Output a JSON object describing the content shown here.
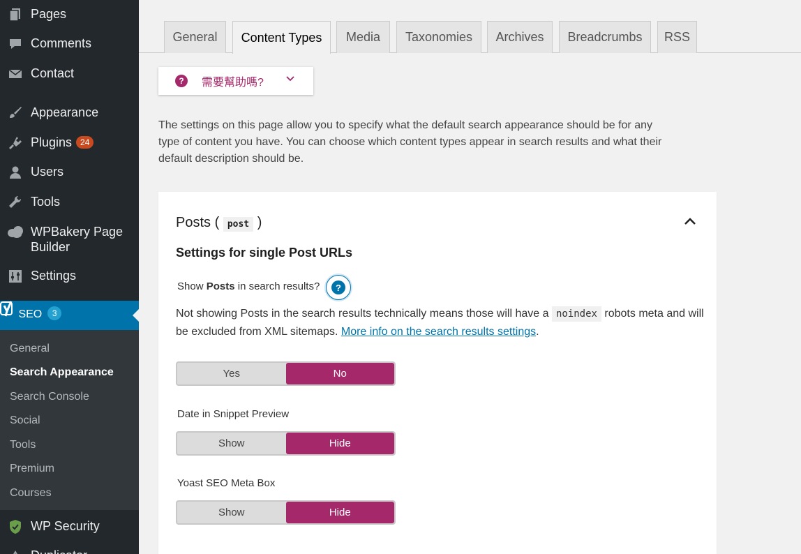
{
  "colors": {
    "sidebar_bg": "#23282d",
    "active_menu": "#0073aa",
    "accent": "#a4286a",
    "link": "#0073aa"
  },
  "sidebar": {
    "items": [
      {
        "label": "Pages",
        "icon": "pages-icon"
      },
      {
        "label": "Comments",
        "icon": "comments-icon"
      },
      {
        "label": "Contact",
        "icon": "mail-icon"
      },
      {
        "label": "Appearance",
        "icon": "paintbrush-icon"
      },
      {
        "label": "Plugins",
        "icon": "plugin-icon",
        "badge": "24"
      },
      {
        "label": "Users",
        "icon": "users-icon"
      },
      {
        "label": "Tools",
        "icon": "wrench-icon"
      },
      {
        "label": "WPBakery Page Builder",
        "icon": "cloud-icon"
      },
      {
        "label": "Settings",
        "icon": "settings-sliders-icon"
      }
    ],
    "seo": {
      "label": "SEO",
      "badge": "3",
      "icon": "yoast-icon"
    },
    "submenu": [
      "General",
      "Search Appearance",
      "Search Console",
      "Social",
      "Tools",
      "Premium",
      "Courses"
    ],
    "active_submenu": "Search Appearance",
    "after": [
      {
        "label": "WP Security",
        "icon": "shield-icon"
      },
      {
        "label": "Duplicator",
        "icon": "duplicator-icon"
      }
    ]
  },
  "tabs": [
    "General",
    "Content Types",
    "Media",
    "Taxonomies",
    "Archives",
    "Breadcrumbs",
    "RSS"
  ],
  "active_tab": "Content Types",
  "help": {
    "label": "需要幫助嗎?"
  },
  "intro": "The settings on this page allow you to specify what the default search appearance should be for any type of content you have. You can choose which content types appear in search results and what their default description should be.",
  "card": {
    "title": "Posts (",
    "title_code": "post",
    "title_close": ")",
    "subtitle": "Settings for single Post URLs",
    "show_label_pre": "Show ",
    "show_label_bold": "Posts",
    "show_label_post": " in search results?",
    "help_mark": "?",
    "desc_pre": "Not showing Posts in the search results technically means those will have a",
    "desc_code": "noindex",
    "desc_mid": "robots meta and will be excluded from XML sitemaps.",
    "desc_link": "More info on the search results settings",
    "desc_end": ".",
    "toggles": [
      {
        "label": "",
        "off": "Yes",
        "on": "No"
      },
      {
        "label": "Date in Snippet Preview",
        "off": "Show",
        "on": "Hide"
      },
      {
        "label": "Yoast SEO Meta Box",
        "off": "Show",
        "on": "Hide"
      }
    ]
  }
}
